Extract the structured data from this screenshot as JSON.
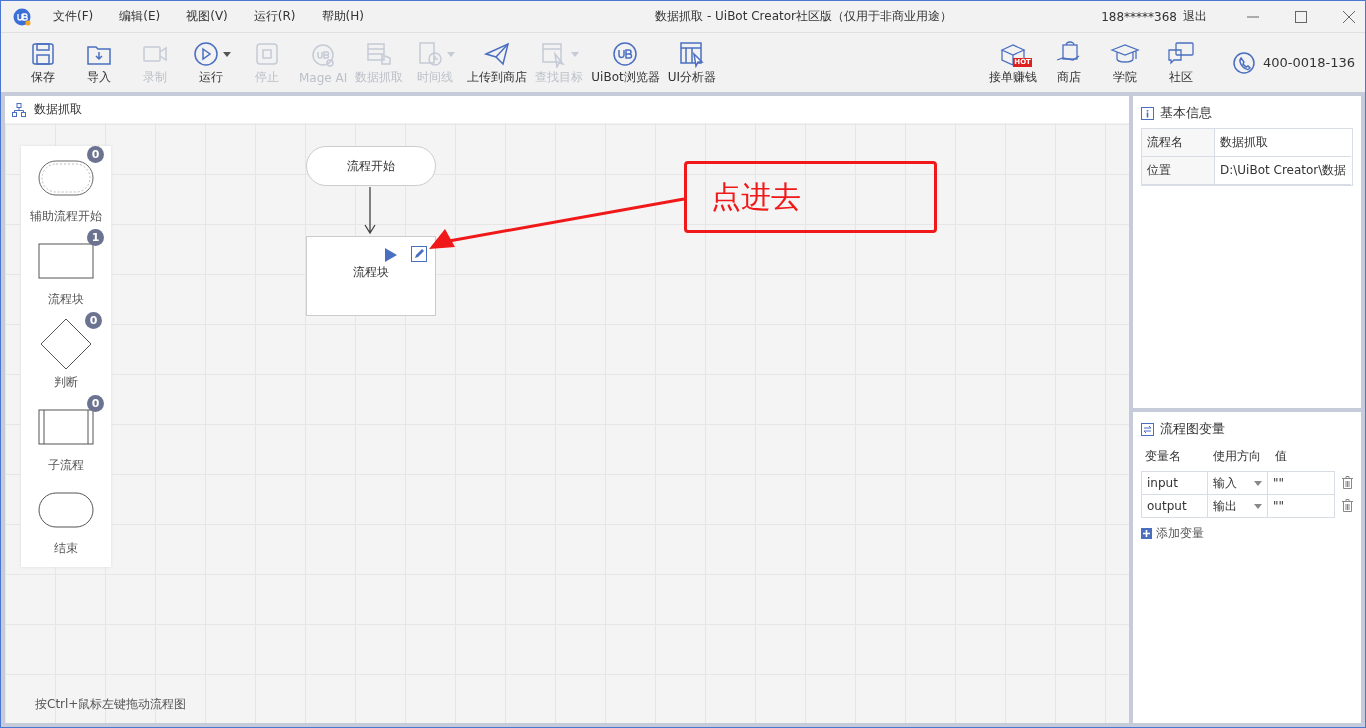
{
  "window": {
    "title": "数据抓取 - UiBot Creator社区版（仅用于非商业用途）",
    "user": "188*****368",
    "logout": "退出"
  },
  "menu": [
    "文件(F)",
    "编辑(E)",
    "视图(V)",
    "运行(R)",
    "帮助(H)"
  ],
  "toolbar": [
    {
      "label": "保存",
      "disabled": false,
      "dropdown": false
    },
    {
      "label": "导入",
      "disabled": false,
      "dropdown": false
    },
    {
      "label": "录制",
      "disabled": true,
      "dropdown": false
    },
    {
      "label": "运行",
      "disabled": false,
      "dropdown": true
    },
    {
      "label": "停止",
      "disabled": true,
      "dropdown": false
    },
    {
      "label": "Mage AI",
      "disabled": true,
      "dropdown": false
    },
    {
      "label": "数据抓取",
      "disabled": true,
      "dropdown": false
    },
    {
      "label": "时间线",
      "disabled": true,
      "dropdown": true
    },
    {
      "label": "上传到商店",
      "disabled": false,
      "dropdown": false
    },
    {
      "label": "查找目标",
      "disabled": true,
      "dropdown": true
    },
    {
      "label": "UiBot浏览器",
      "disabled": false,
      "dropdown": false
    },
    {
      "label": "UI分析器",
      "disabled": false,
      "dropdown": false
    }
  ],
  "toolbar_right": [
    {
      "label": "接单赚钱",
      "badge": "HOT"
    },
    {
      "label": "商店"
    },
    {
      "label": "学院"
    },
    {
      "label": "社区"
    }
  ],
  "phone": "400-0018-136",
  "canvas": {
    "tab": "数据抓取",
    "hint": "按Ctrl+鼠标左键拖动流程图",
    "palette": [
      {
        "kind": "aux-start",
        "label": "辅助流程开始",
        "count": "0"
      },
      {
        "kind": "block",
        "label": "流程块",
        "count": "1"
      },
      {
        "kind": "decision",
        "label": "判断",
        "count": "0"
      },
      {
        "kind": "subflow",
        "label": "子流程",
        "count": "0"
      },
      {
        "kind": "end",
        "label": "结束"
      }
    ],
    "nodes": [
      {
        "kind": "start",
        "label": "流程开始"
      },
      {
        "kind": "block",
        "label": "流程块"
      }
    ],
    "annotation": {
      "text": "点进去"
    }
  },
  "info": {
    "title": "基本信息",
    "rows": [
      {
        "key": "流程名",
        "value": "数据抓取"
      },
      {
        "key": "位置",
        "value": "D:\\UiBot Creator\\数据"
      }
    ]
  },
  "variables": {
    "title": "流程图变量",
    "columns": [
      "变量名",
      "使用方向",
      "值"
    ],
    "rows": [
      {
        "name": "input",
        "direction": "输入",
        "value": "\"\""
      },
      {
        "name": "output",
        "direction": "输出",
        "value": "\"\""
      }
    ],
    "add": "添加变量"
  }
}
